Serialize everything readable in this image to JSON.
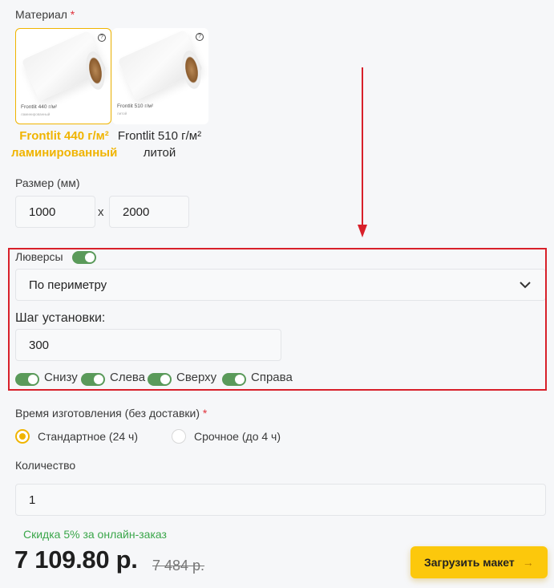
{
  "material": {
    "label": "Материал",
    "required_mark": "*",
    "options": [
      {
        "card_caption": "Frontlit 440 г/м²",
        "card_sub": "ламинированный",
        "name_line1": "Frontlit 440 г/м²",
        "name_line2": "ламинированный",
        "selected": true
      },
      {
        "card_caption": "Frontlit 510 г/м²",
        "card_sub": "литой",
        "name_line1": "Frontlit 510 г/м²",
        "name_line2": "литой",
        "selected": false
      }
    ],
    "help_icon": "?"
  },
  "size": {
    "label": "Размер (мм)",
    "width": "1000",
    "height": "2000",
    "separator": "x"
  },
  "grommets": {
    "label": "Люверсы",
    "enabled": true,
    "placement": "По периметру",
    "step_label": "Шаг установки:",
    "step_value": "300",
    "sides": [
      {
        "label": "Снизу",
        "on": true
      },
      {
        "label": "Слева",
        "on": true
      },
      {
        "label": "Сверху",
        "on": true
      },
      {
        "label": "Справа",
        "on": true
      }
    ]
  },
  "production_time": {
    "label": "Время изготовления (без доставки)",
    "required_mark": "*",
    "options": [
      {
        "label": "Стандартное (24 ч)",
        "selected": true
      },
      {
        "label": "Срочное (до 4 ч)",
        "selected": false
      }
    ]
  },
  "quantity": {
    "label": "Количество",
    "value": "1"
  },
  "pricing": {
    "discount_note": "Скидка 5% за онлайн-заказ",
    "price": "7 109.80 р.",
    "old_price": "7 484 р."
  },
  "upload_button": {
    "label": "Загрузить макет",
    "arrow": "→"
  },
  "colors": {
    "accent": "#fcc80c",
    "selected_text": "#f0b400",
    "toggle_on": "#5a9a5a",
    "discount": "#3aa64a",
    "annotation_red": "#d8202a"
  }
}
